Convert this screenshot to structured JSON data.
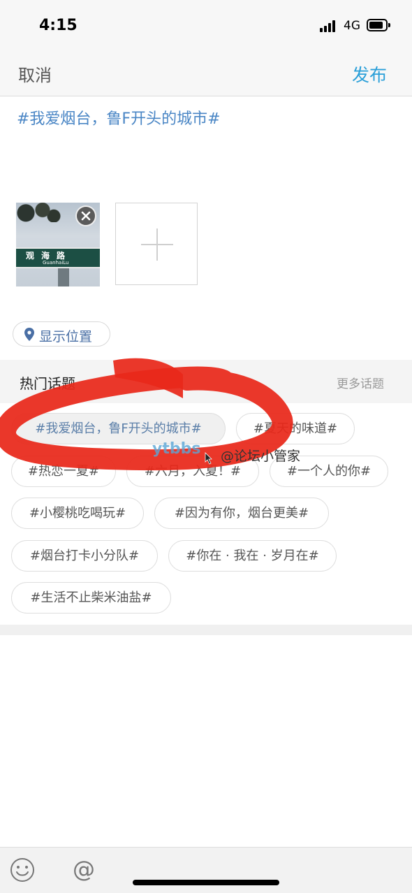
{
  "status_bar": {
    "time": "4:15",
    "network": "4G",
    "icons": [
      "signal-icon",
      "battery-icon"
    ]
  },
  "nav": {
    "cancel_label": "取消",
    "publish_label": "发布"
  },
  "post": {
    "text": "#我爱烟台，鲁F开头的城市#"
  },
  "photo": {
    "sign_text": "观海路",
    "sign_sub": "GuanhaiLu"
  },
  "location": {
    "label": "显示位置",
    "icon": "location-pin-icon"
  },
  "topics": {
    "title": "热门话题",
    "more_label": "更多话题",
    "items": [
      {
        "label": "#我爱烟台，鲁F开头的城市#",
        "selected": true
      },
      {
        "label": "#夏天的味道#",
        "selected": false
      },
      {
        "label": "#热恋一夏#",
        "selected": false
      },
      {
        "label": "#六月，入夏！#",
        "selected": false
      },
      {
        "label": "#一个人的你#",
        "selected": false
      },
      {
        "label": "#小樱桃吃喝玩#",
        "selected": false
      },
      {
        "label": "#因为有你，烟台更美#",
        "selected": false
      },
      {
        "label": "#烟台打卡小分队#",
        "selected": false
      },
      {
        "label": "#你在 · 我在 · 岁月在#",
        "selected": false
      },
      {
        "label": "#生活不止柴米油盐#",
        "selected": false
      }
    ]
  },
  "watermark": {
    "brand": "ytbbs",
    "handle": "@论坛小管家"
  },
  "bottom_bar": {
    "at_label": "@",
    "icons": [
      "emoji-icon",
      "at-icon"
    ]
  },
  "colors": {
    "accent": "#2a9fd8",
    "topic_blue": "#4a86c5",
    "highlight_red": "#e8281a"
  }
}
